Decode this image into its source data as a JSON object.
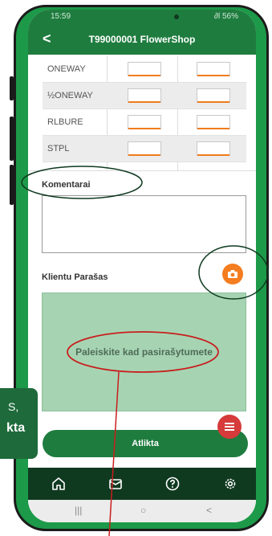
{
  "status_bar": {
    "time": "15:59",
    "right": "∂l 56%"
  },
  "header": {
    "back": "<",
    "title": "T99000001 FlowerShop"
  },
  "table": {
    "rows": [
      {
        "label": "ONEWAY"
      },
      {
        "label": "½ONEWAY"
      },
      {
        "label": "RLBURE"
      },
      {
        "label": "STPL"
      }
    ]
  },
  "comments": {
    "label": "Komentarai",
    "value": ""
  },
  "signature": {
    "label": "Klientu Parašas",
    "hint": "Paleiskite kad pasirašytumete"
  },
  "actions": {
    "submit_label": "Atlikta"
  },
  "bottom_nav": {
    "items": [
      "home-icon",
      "mail-icon",
      "help-icon",
      "settings-icon"
    ]
  },
  "system_nav": {
    "recents": "|||",
    "home": "○",
    "back": "<"
  },
  "tooltip": {
    "line1": "S,",
    "line2": "kta"
  },
  "colors": {
    "primary": "#1f7c3f",
    "accent": "#f47d20",
    "danger": "#d63a3a",
    "signature_bg": "#a6d4b2"
  }
}
